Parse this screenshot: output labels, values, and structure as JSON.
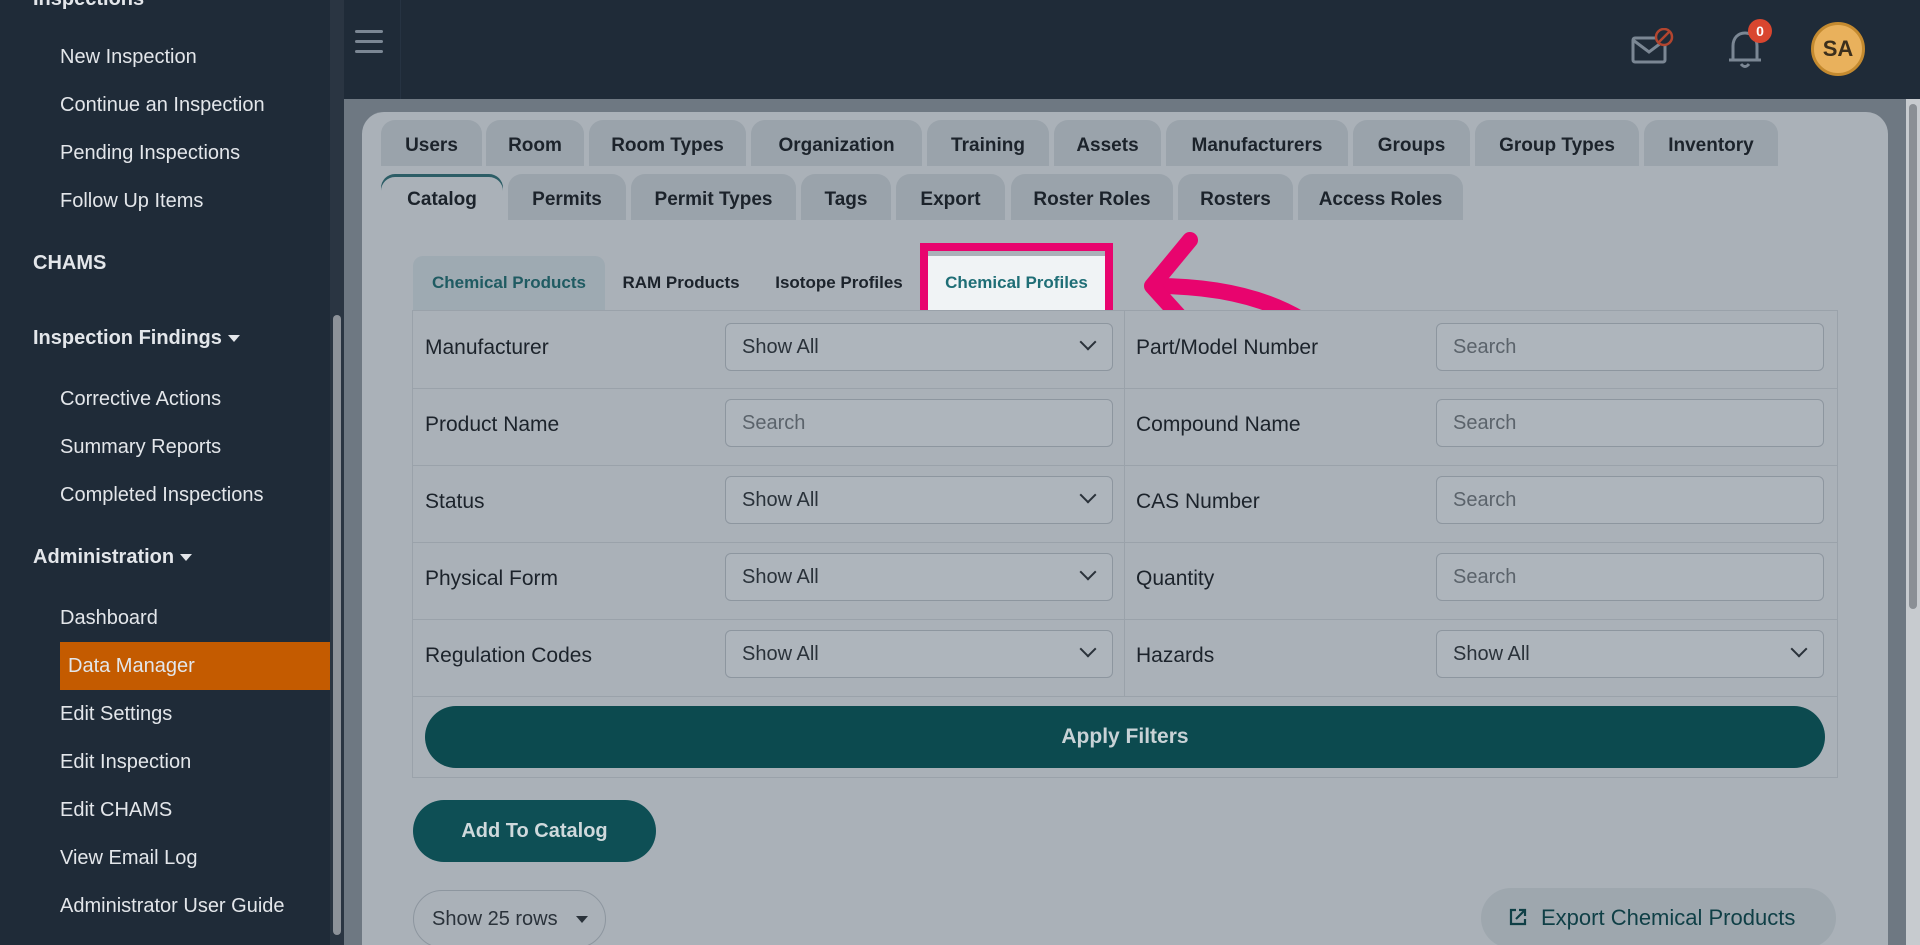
{
  "sidebar": {
    "section_top_cut": "Inspections",
    "inspection_items": [
      "New Inspection",
      "Continue an Inspection",
      "Pending Inspections",
      "Follow Up Items"
    ],
    "chams_label": "CHAMS",
    "findings_label": "Inspection Findings",
    "findings_items": [
      "Corrective Actions",
      "Summary Reports",
      "Completed Inspections"
    ],
    "admin_label": "Administration",
    "admin_items": [
      "Dashboard",
      "Data Manager",
      "Edit Settings",
      "Edit Inspection",
      "Edit CHAMS",
      "View Email Log",
      "Administrator User Guide"
    ],
    "active_item": "Data Manager"
  },
  "header": {
    "notification_count": "0",
    "avatar_initials": "SA"
  },
  "tabs_row1": [
    "Users",
    "Room",
    "Room Types",
    "Organization",
    "Training",
    "Assets",
    "Manufacturers",
    "Groups",
    "Group Types",
    "Inventory"
  ],
  "tabs_row2": [
    "Catalog",
    "Permits",
    "Permit Types",
    "Tags",
    "Export",
    "Roster Roles",
    "Rosters",
    "Access Roles"
  ],
  "active_tab": "Catalog",
  "subtabs": [
    "Chemical Products",
    "RAM Products",
    "Isotope Profiles",
    "Chemical Profiles"
  ],
  "active_subtab": "Chemical Products",
  "highlighted_subtab": "Chemical Profiles",
  "filters": {
    "manufacturer": {
      "label": "Manufacturer",
      "value": "Show All"
    },
    "part_model": {
      "label": "Part/Model Number",
      "placeholder": "Search"
    },
    "product_name": {
      "label": "Product Name",
      "placeholder": "Search"
    },
    "compound_name": {
      "label": "Compound Name",
      "placeholder": "Search"
    },
    "status": {
      "label": "Status",
      "value": "Show All"
    },
    "cas_number": {
      "label": "CAS Number",
      "placeholder": "Search"
    },
    "physical_form": {
      "label": "Physical Form",
      "value": "Show All"
    },
    "quantity": {
      "label": "Quantity",
      "placeholder": "Search"
    },
    "regulation_codes": {
      "label": "Regulation Codes",
      "value": "Show All"
    },
    "hazards": {
      "label": "Hazards",
      "value": "Show All"
    }
  },
  "buttons": {
    "apply_filters": "Apply Filters",
    "add_to_catalog": "Add To Catalog",
    "rows_select": "Show 25 rows",
    "export": "Export Chemical Products"
  },
  "colors": {
    "highlight": "#e8046e",
    "active_nav": "#c45b00",
    "primary_button": "#0c4a4f"
  }
}
